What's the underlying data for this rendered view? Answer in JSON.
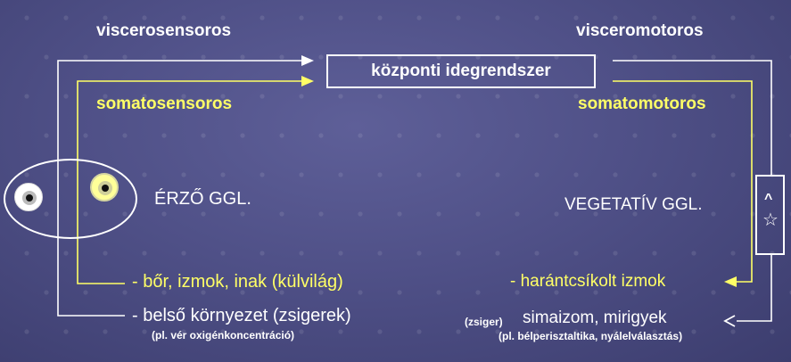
{
  "labels": {
    "viscerosensory": "viscerosensoros",
    "visceromotor": "visceromotoros",
    "somatosensory": "somatosensoros",
    "somatomotor": "somatomotoros",
    "cns": "központi idegrendszer",
    "sensory_ganglion": "ÉRZŐ GGL.",
    "vegetative_ganglion": "VEGETATÍV  GGL.",
    "skin_muscles": "- bőr, izmok, inak (külvilág)",
    "internal_env": "- belső környezet (zsigerek)",
    "internal_env_example": "(pl. vér oxigénkoncentráció)",
    "striated_muscles": "- harántcsíkolt izmok",
    "visceral_prefix": "(zsiger)",
    "smooth_glands": "simaizom, mirigyek",
    "smooth_glands_example": "(pl. bélperisztaltika, nyálelválasztás)"
  },
  "colors": {
    "somatic_pathway": "#ffff66",
    "visceral_pathway": "#ffffff",
    "background": "#4f5087"
  },
  "icons": {
    "vegetative_arrow": "^",
    "vegetative_star": "☆"
  }
}
